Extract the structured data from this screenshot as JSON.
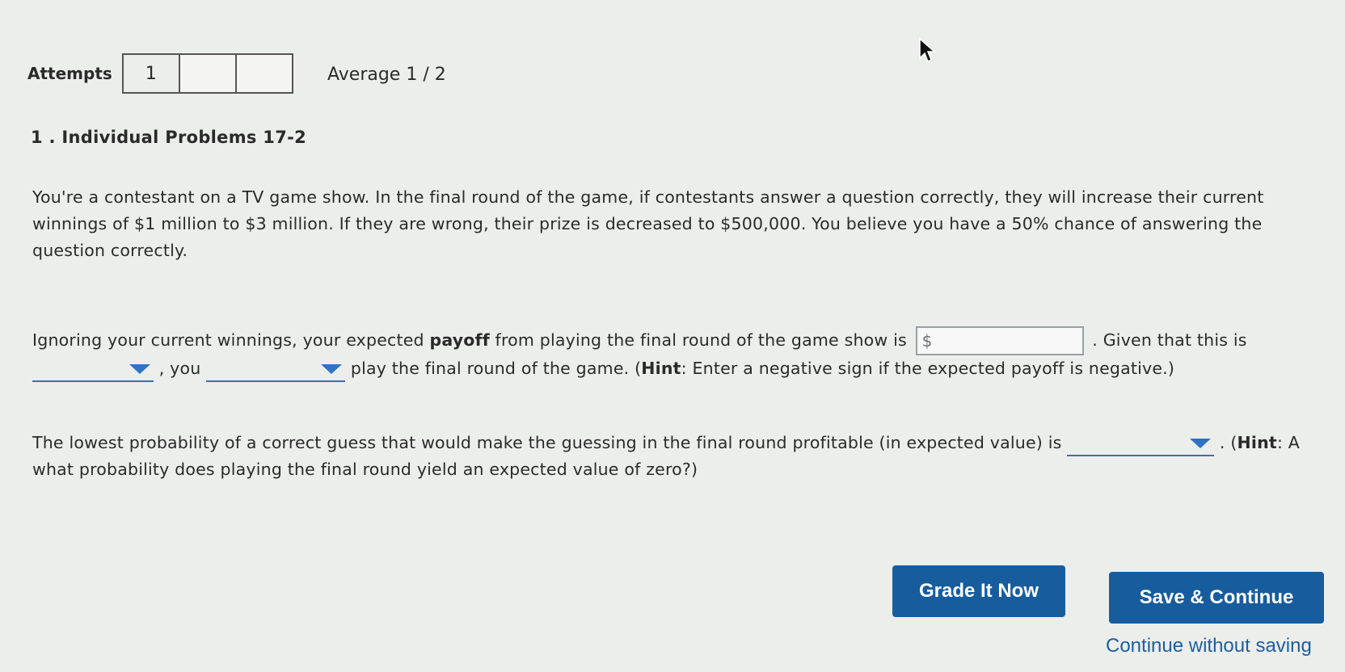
{
  "attempts": {
    "label": "Attempts",
    "boxes": [
      "1",
      "",
      ""
    ]
  },
  "average": "Average 1 / 2",
  "problem": {
    "title": "1 . Individual Problems 17-2",
    "paragraph1": "You're a contestant on a TV game show. In the final round of the game, if contestants answer a question correctly, they will increase their current winnings of $1 million to $3 million. If they are wrong, their prize is decreased to $500,000. You believe you have a 50% chance of answering the question correctly.",
    "p2_part1": "Ignoring your current winnings, your expected ",
    "p2_payoff": "payoff",
    "p2_part2": " from playing the final round of the game show is",
    "dollar_sign": "$",
    "dollar_value": "",
    "p2_part3": ". Given that this is",
    "p2_you": ", you",
    "p2_part4": "play the final round of the game. (",
    "hint_label": "Hint",
    "p2_hint_text": ": Enter a negative sign if the expected payoff is negative.)",
    "dropdown1_value": "",
    "dropdown2_value": "",
    "p3_part1": "The lowest probability of a correct guess that would make the guessing in the final round profitable (in expected value) is",
    "dropdown3_value": "",
    "p3_part2": ". (",
    "p3_hint_label": "Hint",
    "p3_hint_text": ": A",
    "p3_part3": "what probability does playing the final round yield an expected value of zero?)"
  },
  "buttons": {
    "grade": "Grade It Now",
    "save": "Save & Continue",
    "continue_without_saving": "Continue without saving"
  },
  "icons": {
    "cursor": "mouse-pointer-icon",
    "dropdown": "triangle-down-icon"
  },
  "colors": {
    "button_bg": "#175d9e",
    "link": "#1d5e9e",
    "dropdown_arrow": "#2f73c4"
  }
}
